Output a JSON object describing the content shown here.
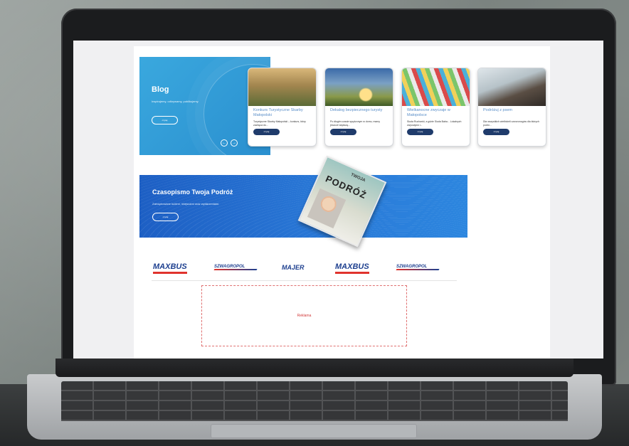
{
  "blog": {
    "title": "Blog",
    "subtitle": "Inspirujemy, odkrywamy, publikujemy.",
    "button": "czytaj",
    "prev": "←",
    "next": "→"
  },
  "cards": [
    {
      "title": "Konkurs Turystyczne Skarby Małopolski",
      "text": "Turystyczne Skarby Małopolski – konkurs, który zachęca do...",
      "button": "czytaj"
    },
    {
      "title": "Dekalog bezpiecznego turysty",
      "text": "Po długim czasie spędzonym w domu, mamy jeszcze większą...",
      "button": "czytaj"
    },
    {
      "title": "Wielkanocne zwyczaje w Małopolsce",
      "text": "Siuda Ruchanki, a gdzie Siuda Baba... Lokalnych zwyczajów i...",
      "button": "czytaj"
    },
    {
      "title": "Podróżuj z psem",
      "text": "Dla wszystkich wielbicieli czworonogów dla których podró...",
      "button": "czytaj"
    }
  ],
  "magazine": {
    "title": "Czasopismo Twoja Podróż",
    "subtitle": "Zainspirowane ludźmi, miejscami oraz wydarzeniami.",
    "button": "czytaj",
    "cover_title": "PODRÓŻ",
    "cover_tag": "TWOJA"
  },
  "partners": {
    "maxbus1": "MAXBUS",
    "szw1": "SZWAGROPOL",
    "majer": "MAJER",
    "maxbus2": "MAXBUS",
    "szw2": "SZWAGROPOL"
  },
  "ad": {
    "label": "Reklama"
  },
  "colors": {
    "blog_bg": "#2a8fcf",
    "magazine_bg": "#1d5fc4",
    "button_dark": "#1f3b6b",
    "title_blue": "#5b8fc8"
  }
}
